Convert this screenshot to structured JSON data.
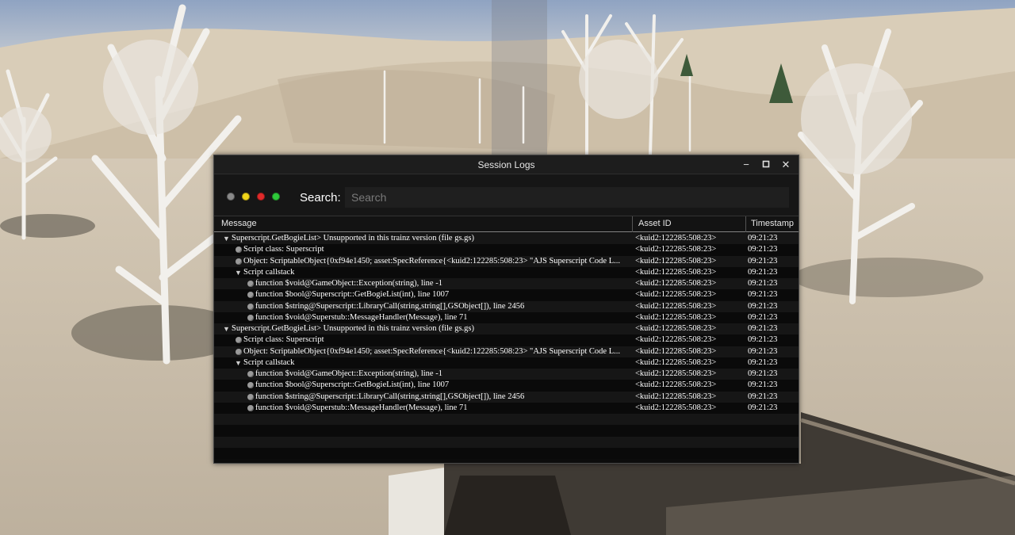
{
  "window": {
    "title": "Session Logs",
    "controls": {
      "minimize": "−",
      "maximize": "▫",
      "close": "✕"
    }
  },
  "toolbar": {
    "dots": [
      {
        "name": "gray-filter-dot",
        "color": "#8a8a8a"
      },
      {
        "name": "yellow-filter-dot",
        "color": "#f0d51a"
      },
      {
        "name": "red-filter-dot",
        "color": "#e02a2a"
      },
      {
        "name": "green-filter-dot",
        "color": "#2ec93a"
      }
    ],
    "search_label": "Search:",
    "search_placeholder": "Search",
    "search_value": ""
  },
  "table": {
    "columns": {
      "message": "Message",
      "asset": "Asset ID",
      "timestamp": "Timestamp"
    },
    "rows": [
      {
        "level": 0,
        "kind": "expanded",
        "text": "Superscript.GetBogieList> Unsupported in this trainz version (file gs.gs)",
        "asset": "<kuid2:122285:508:23>",
        "time": "09:21:23"
      },
      {
        "level": 1,
        "kind": "bullet",
        "text": "Script class: Superscript",
        "asset": "<kuid2:122285:508:23>",
        "time": "09:21:23"
      },
      {
        "level": 1,
        "kind": "bullet",
        "text": "Object: ScriptableObject{0xf94e1450; asset:SpecReference{<kuid2:122285:508:23> \"AJS Superscript Code L...",
        "asset": "<kuid2:122285:508:23>",
        "time": "09:21:23"
      },
      {
        "level": 1,
        "kind": "expanded",
        "text": "Script callstack",
        "asset": "<kuid2:122285:508:23>",
        "time": "09:21:23"
      },
      {
        "level": 2,
        "kind": "bullet",
        "text": "function $void@GameObject::Exception(string), line -1",
        "asset": "<kuid2:122285:508:23>",
        "time": "09:21:23"
      },
      {
        "level": 2,
        "kind": "bullet",
        "text": "function $bool@Superscript::GetBogieList(int), line 1007",
        "asset": "<kuid2:122285:508:23>",
        "time": "09:21:23"
      },
      {
        "level": 2,
        "kind": "bullet",
        "text": "function $string@Superscript::LibraryCall(string,string[],GSObject[]), line 2456",
        "asset": "<kuid2:122285:508:23>",
        "time": "09:21:23"
      },
      {
        "level": 2,
        "kind": "bullet",
        "text": "function $void@Superstub::MessageHandler(Message), line 71",
        "asset": "<kuid2:122285:508:23>",
        "time": "09:21:23"
      },
      {
        "level": 0,
        "kind": "expanded",
        "text": "Superscript.GetBogieList> Unsupported in this trainz version (file gs.gs)",
        "asset": "<kuid2:122285:508:23>",
        "time": "09:21:23"
      },
      {
        "level": 1,
        "kind": "bullet",
        "text": "Script class: Superscript",
        "asset": "<kuid2:122285:508:23>",
        "time": "09:21:23"
      },
      {
        "level": 1,
        "kind": "bullet",
        "text": "Object: ScriptableObject{0xf94e1450; asset:SpecReference{<kuid2:122285:508:23> \"AJS Superscript Code L...",
        "asset": "<kuid2:122285:508:23>",
        "time": "09:21:23"
      },
      {
        "level": 1,
        "kind": "expanded",
        "text": "Script callstack",
        "asset": "<kuid2:122285:508:23>",
        "time": "09:21:23"
      },
      {
        "level": 2,
        "kind": "bullet",
        "text": "function $void@GameObject::Exception(string), line -1",
        "asset": "<kuid2:122285:508:23>",
        "time": "09:21:23"
      },
      {
        "level": 2,
        "kind": "bullet",
        "text": "function $bool@Superscript::GetBogieList(int), line 1007",
        "asset": "<kuid2:122285:508:23>",
        "time": "09:21:23"
      },
      {
        "level": 2,
        "kind": "bullet",
        "text": "function $string@Superscript::LibraryCall(string,string[],GSObject[]), line 2456",
        "asset": "<kuid2:122285:508:23>",
        "time": "09:21:23"
      },
      {
        "level": 2,
        "kind": "bullet",
        "text": "function $void@Superstub::MessageHandler(Message), line 71",
        "asset": "<kuid2:122285:508:23>",
        "time": "09:21:23"
      }
    ],
    "empty_rows": 4
  }
}
